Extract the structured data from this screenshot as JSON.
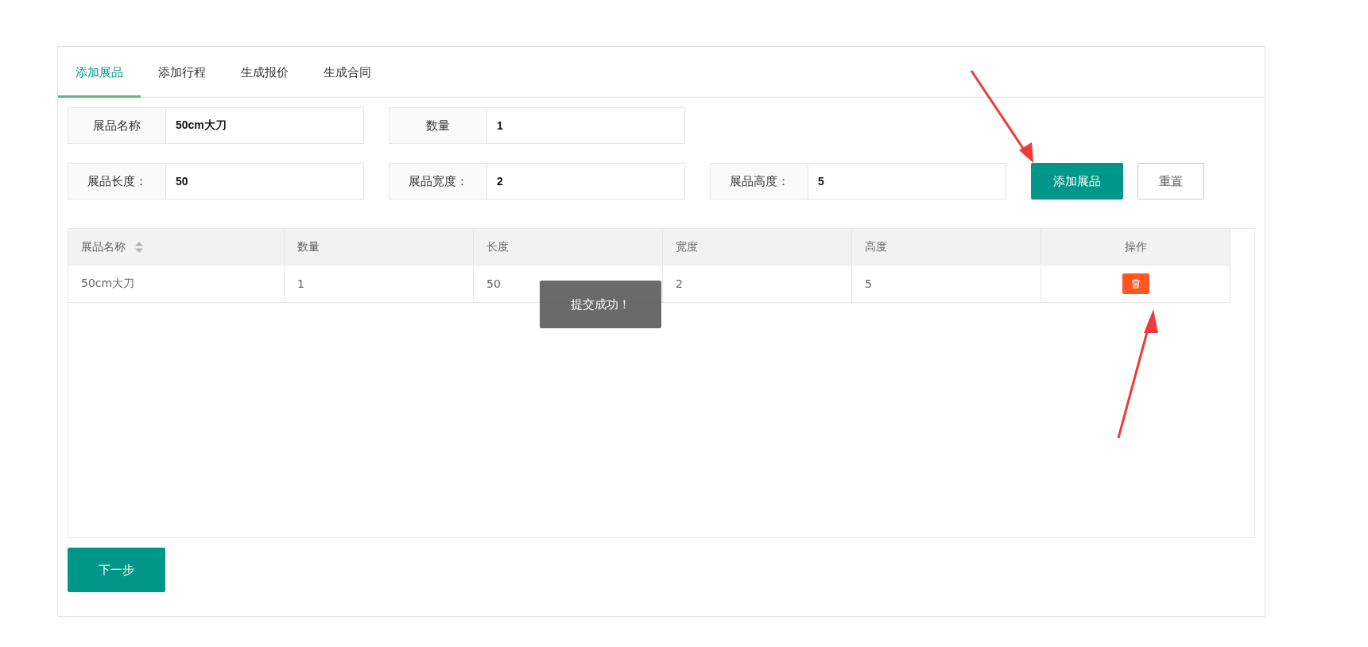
{
  "tabs": [
    {
      "label": "添加展品",
      "selected": true
    },
    {
      "label": "添加行程",
      "selected": false
    },
    {
      "label": "生成报价",
      "selected": false
    },
    {
      "label": "生成合同",
      "selected": false
    }
  ],
  "form_rows": [
    [
      {
        "label": "展品名称",
        "value": "50cm大刀"
      },
      {
        "label": "数量",
        "value": "1"
      }
    ],
    [
      {
        "label": "展品长度：",
        "value": "50"
      },
      {
        "label": "展品宽度：",
        "value": "2"
      },
      {
        "label": "展品高度：",
        "value": "5"
      }
    ]
  ],
  "form_buttons": [
    {
      "kind": "primary",
      "label": "添加展品"
    },
    {
      "kind": "default",
      "label": "重置"
    }
  ],
  "table": {
    "columns": [
      {
        "label": "展品名称",
        "sortable": true
      },
      {
        "label": "数量",
        "sortable": false
      },
      {
        "label": "长度",
        "sortable": false
      },
      {
        "label": "宽度",
        "sortable": false
      },
      {
        "label": "高度",
        "sortable": false
      },
      {
        "label": "操作",
        "sortable": false
      }
    ],
    "rows": [
      {
        "cells": [
          "50cm大刀",
          "1",
          "50",
          "2",
          "5"
        ]
      }
    ]
  },
  "toast": "提交成功！",
  "next_button": "下一步"
}
